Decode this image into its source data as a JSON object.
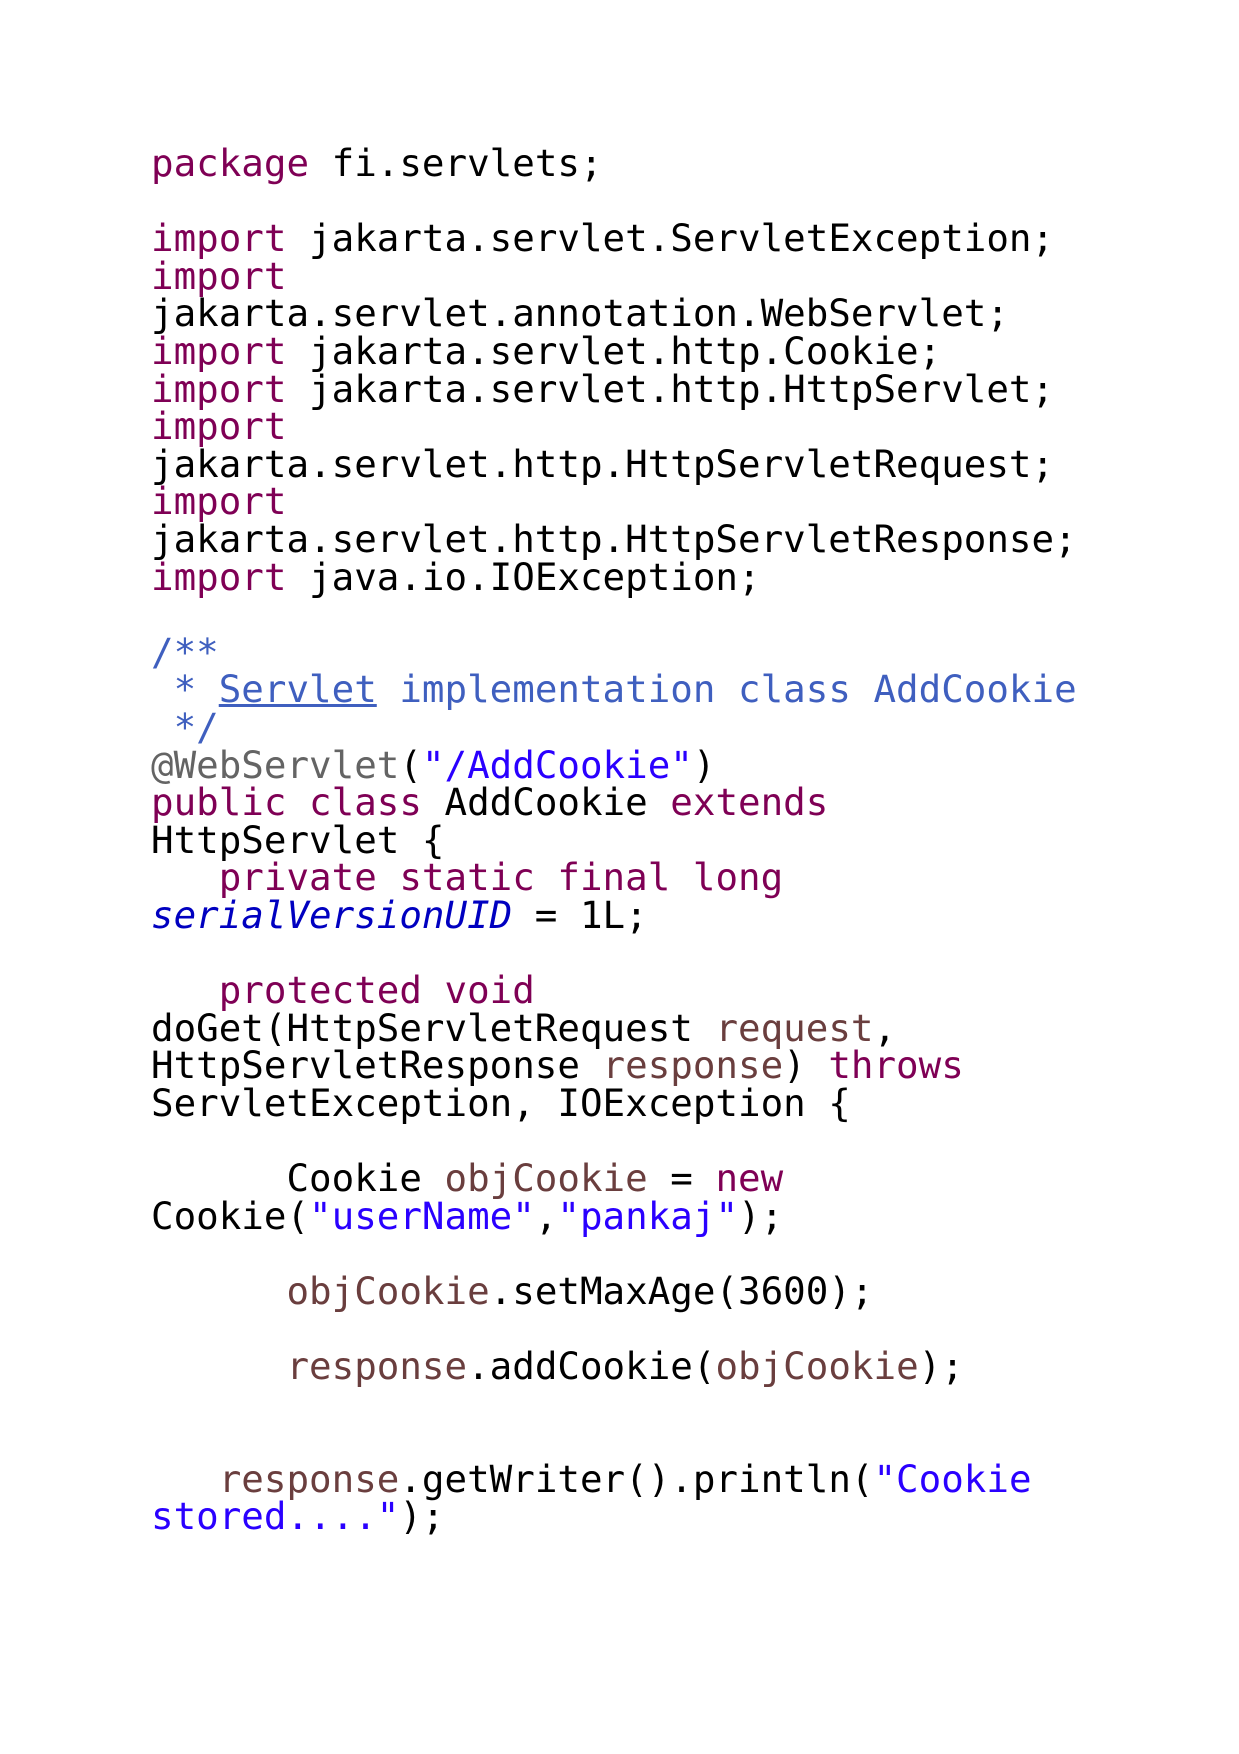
{
  "document": {
    "language": "java",
    "colors": {
      "keyword": "#7f0055",
      "string": "#2a00ff",
      "comment": "#3f5fbf",
      "annotation": "#646464",
      "static_field": "#0000c0",
      "variable": "#6a3e3e",
      "plain": "#000000",
      "background": "#ffffff"
    },
    "lines": [
      [
        {
          "t": "kw",
          "v": "package"
        },
        {
          "t": "pln",
          "v": " fi.servlets;"
        }
      ],
      [],
      [
        {
          "t": "kw",
          "v": "import"
        },
        {
          "t": "pln",
          "v": " jakarta.servlet.ServletException;"
        }
      ],
      [
        {
          "t": "kw",
          "v": "import"
        }
      ],
      [
        {
          "t": "pln",
          "v": "jakarta.servlet.annotation.WebServlet;"
        }
      ],
      [
        {
          "t": "kw",
          "v": "import"
        },
        {
          "t": "pln",
          "v": " jakarta.servlet.http.Cookie;"
        }
      ],
      [
        {
          "t": "kw",
          "v": "import"
        },
        {
          "t": "pln",
          "v": " jakarta.servlet.http.HttpServlet;"
        }
      ],
      [
        {
          "t": "kw",
          "v": "import"
        }
      ],
      [
        {
          "t": "pln",
          "v": "jakarta.servlet.http.HttpServletRequest;"
        }
      ],
      [
        {
          "t": "kw",
          "v": "import"
        }
      ],
      [
        {
          "t": "pln",
          "v": "jakarta.servlet.http.HttpServletResponse;"
        }
      ],
      [
        {
          "t": "kw",
          "v": "import"
        },
        {
          "t": "pln",
          "v": " java.io.IOException;"
        }
      ],
      [],
      [
        {
          "t": "cmt",
          "v": "/**"
        }
      ],
      [
        {
          "t": "cmt",
          "v": " * "
        },
        {
          "t": "cmt-link",
          "v": "Servlet"
        },
        {
          "t": "cmt",
          "v": " implementation class AddCookie"
        }
      ],
      [
        {
          "t": "cmt",
          "v": " */"
        }
      ],
      [
        {
          "t": "ann",
          "v": "@WebServlet"
        },
        {
          "t": "pln",
          "v": "("
        },
        {
          "t": "str",
          "v": "\"/AddCookie\""
        },
        {
          "t": "pln",
          "v": ")"
        }
      ],
      [
        {
          "t": "kw",
          "v": "public"
        },
        {
          "t": "pln",
          "v": " "
        },
        {
          "t": "kw",
          "v": "class"
        },
        {
          "t": "pln",
          "v": " AddCookie "
        },
        {
          "t": "kw",
          "v": "extends"
        }
      ],
      [
        {
          "t": "pln",
          "v": "HttpServlet {"
        }
      ],
      [
        {
          "t": "pln",
          "v": "   "
        },
        {
          "t": "kw",
          "v": "private"
        },
        {
          "t": "pln",
          "v": " "
        },
        {
          "t": "kw",
          "v": "static"
        },
        {
          "t": "pln",
          "v": " "
        },
        {
          "t": "kw",
          "v": "final"
        },
        {
          "t": "pln",
          "v": " "
        },
        {
          "t": "kw",
          "v": "long"
        }
      ],
      [
        {
          "t": "fld",
          "v": "serialVersionUID"
        },
        {
          "t": "pln",
          "v": " = 1L;"
        }
      ],
      [],
      [
        {
          "t": "pln",
          "v": "   "
        },
        {
          "t": "kw",
          "v": "protected"
        },
        {
          "t": "pln",
          "v": " "
        },
        {
          "t": "kw",
          "v": "void"
        }
      ],
      [
        {
          "t": "pln",
          "v": "doGet(HttpServletRequest "
        },
        {
          "t": "var",
          "v": "request"
        },
        {
          "t": "pln",
          "v": ","
        }
      ],
      [
        {
          "t": "pln",
          "v": "HttpServletResponse "
        },
        {
          "t": "var",
          "v": "response"
        },
        {
          "t": "pln",
          "v": ") "
        },
        {
          "t": "kw",
          "v": "throws"
        }
      ],
      [
        {
          "t": "pln",
          "v": "ServletException, IOException {"
        }
      ],
      [],
      [
        {
          "t": "pln",
          "v": "      Cookie "
        },
        {
          "t": "var",
          "v": "objCookie"
        },
        {
          "t": "pln",
          "v": " = "
        },
        {
          "t": "kw",
          "v": "new"
        }
      ],
      [
        {
          "t": "pln",
          "v": "Cookie("
        },
        {
          "t": "str",
          "v": "\"userName\""
        },
        {
          "t": "pln",
          "v": ","
        },
        {
          "t": "str",
          "v": "\"pankaj\""
        },
        {
          "t": "pln",
          "v": ");"
        }
      ],
      [],
      [
        {
          "t": "pln",
          "v": "      "
        },
        {
          "t": "var",
          "v": "objCookie"
        },
        {
          "t": "pln",
          "v": ".setMaxAge(3600);"
        }
      ],
      [],
      [
        {
          "t": "pln",
          "v": "      "
        },
        {
          "t": "var",
          "v": "response"
        },
        {
          "t": "pln",
          "v": ".addCookie("
        },
        {
          "t": "var",
          "v": "objCookie"
        },
        {
          "t": "pln",
          "v": ");"
        }
      ],
      [],
      [],
      [
        {
          "t": "pln",
          "v": "   "
        },
        {
          "t": "var",
          "v": "response"
        },
        {
          "t": "pln",
          "v": ".getWriter().println("
        },
        {
          "t": "str",
          "v": "\"Cookie"
        }
      ],
      [
        {
          "t": "str",
          "v": "stored....\""
        },
        {
          "t": "pln",
          "v": ");"
        }
      ]
    ]
  }
}
